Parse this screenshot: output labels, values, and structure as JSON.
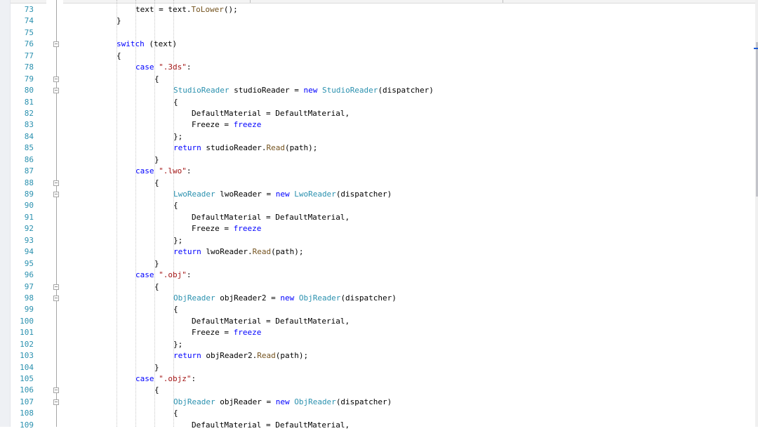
{
  "editor": {
    "colors": {
      "line_number": "#2b91af",
      "keyword": "#0000ff",
      "type": "#2b91af",
      "string": "#a31515",
      "method": "#74531f",
      "text": "#000000"
    },
    "lines": [
      {
        "no": "73",
        "indent": 4,
        "fold": "",
        "tokens": [
          {
            "t": "text = text.",
            "c": "plain"
          },
          {
            "t": "ToLower",
            "c": "meth"
          },
          {
            "t": "();",
            "c": "plain"
          }
        ]
      },
      {
        "no": "74",
        "indent": 3,
        "fold": "",
        "tokens": [
          {
            "t": "}",
            "c": "plain"
          }
        ]
      },
      {
        "no": "75",
        "indent": 0,
        "fold": "",
        "tokens": []
      },
      {
        "no": "76",
        "indent": 3,
        "fold": "minus",
        "tokens": [
          {
            "t": "switch",
            "c": "kw"
          },
          {
            "t": " (text)",
            "c": "plain"
          }
        ]
      },
      {
        "no": "77",
        "indent": 3,
        "fold": "",
        "tokens": [
          {
            "t": "{",
            "c": "plain"
          }
        ]
      },
      {
        "no": "78",
        "indent": 4,
        "fold": "",
        "tokens": [
          {
            "t": "case",
            "c": "kw"
          },
          {
            "t": " ",
            "c": "plain"
          },
          {
            "t": "\".3ds\"",
            "c": "str"
          },
          {
            "t": ":",
            "c": "plain"
          }
        ]
      },
      {
        "no": "79",
        "indent": 5,
        "fold": "minus",
        "tokens": [
          {
            "t": "{",
            "c": "plain"
          }
        ]
      },
      {
        "no": "80",
        "indent": 6,
        "fold": "minus",
        "tokens": [
          {
            "t": "StudioReader",
            "c": "type"
          },
          {
            "t": " studioReader = ",
            "c": "plain"
          },
          {
            "t": "new",
            "c": "kw"
          },
          {
            "t": " ",
            "c": "plain"
          },
          {
            "t": "StudioReader",
            "c": "type"
          },
          {
            "t": "(dispatcher)",
            "c": "plain"
          }
        ]
      },
      {
        "no": "81",
        "indent": 6,
        "fold": "",
        "tokens": [
          {
            "t": "{",
            "c": "plain"
          }
        ]
      },
      {
        "no": "82",
        "indent": 7,
        "fold": "",
        "tokens": [
          {
            "t": "DefaultMaterial = DefaultMaterial,",
            "c": "plain"
          }
        ]
      },
      {
        "no": "83",
        "indent": 7,
        "fold": "",
        "tokens": [
          {
            "t": "Freeze = ",
            "c": "plain"
          },
          {
            "t": "freeze",
            "c": "kw"
          }
        ]
      },
      {
        "no": "84",
        "indent": 6,
        "fold": "",
        "tokens": [
          {
            "t": "};",
            "c": "plain"
          }
        ]
      },
      {
        "no": "85",
        "indent": 6,
        "fold": "",
        "tokens": [
          {
            "t": "return",
            "c": "kw"
          },
          {
            "t": " studioReader.",
            "c": "plain"
          },
          {
            "t": "Read",
            "c": "meth"
          },
          {
            "t": "(path);",
            "c": "plain"
          }
        ]
      },
      {
        "no": "86",
        "indent": 5,
        "fold": "",
        "tokens": [
          {
            "t": "}",
            "c": "plain"
          }
        ]
      },
      {
        "no": "87",
        "indent": 4,
        "fold": "",
        "tokens": [
          {
            "t": "case",
            "c": "kw"
          },
          {
            "t": " ",
            "c": "plain"
          },
          {
            "t": "\".lwo\"",
            "c": "str"
          },
          {
            "t": ":",
            "c": "plain"
          }
        ]
      },
      {
        "no": "88",
        "indent": 5,
        "fold": "minus",
        "tokens": [
          {
            "t": "{",
            "c": "plain"
          }
        ]
      },
      {
        "no": "89",
        "indent": 6,
        "fold": "minus",
        "tokens": [
          {
            "t": "LwoReader",
            "c": "type"
          },
          {
            "t": " lwoReader = ",
            "c": "plain"
          },
          {
            "t": "new",
            "c": "kw"
          },
          {
            "t": " ",
            "c": "plain"
          },
          {
            "t": "LwoReader",
            "c": "type"
          },
          {
            "t": "(dispatcher)",
            "c": "plain"
          }
        ]
      },
      {
        "no": "90",
        "indent": 6,
        "fold": "",
        "tokens": [
          {
            "t": "{",
            "c": "plain"
          }
        ]
      },
      {
        "no": "91",
        "indent": 7,
        "fold": "",
        "tokens": [
          {
            "t": "DefaultMaterial = DefaultMaterial,",
            "c": "plain"
          }
        ]
      },
      {
        "no": "92",
        "indent": 7,
        "fold": "",
        "tokens": [
          {
            "t": "Freeze = ",
            "c": "plain"
          },
          {
            "t": "freeze",
            "c": "kw"
          }
        ]
      },
      {
        "no": "93",
        "indent": 6,
        "fold": "",
        "tokens": [
          {
            "t": "};",
            "c": "plain"
          }
        ]
      },
      {
        "no": "94",
        "indent": 6,
        "fold": "",
        "tokens": [
          {
            "t": "return",
            "c": "kw"
          },
          {
            "t": " lwoReader.",
            "c": "plain"
          },
          {
            "t": "Read",
            "c": "meth"
          },
          {
            "t": "(path);",
            "c": "plain"
          }
        ]
      },
      {
        "no": "95",
        "indent": 5,
        "fold": "",
        "tokens": [
          {
            "t": "}",
            "c": "plain"
          }
        ]
      },
      {
        "no": "96",
        "indent": 4,
        "fold": "",
        "tokens": [
          {
            "t": "case",
            "c": "kw"
          },
          {
            "t": " ",
            "c": "plain"
          },
          {
            "t": "\".obj\"",
            "c": "str"
          },
          {
            "t": ":",
            "c": "plain"
          }
        ]
      },
      {
        "no": "97",
        "indent": 5,
        "fold": "minus",
        "tokens": [
          {
            "t": "{",
            "c": "plain"
          }
        ]
      },
      {
        "no": "98",
        "indent": 6,
        "fold": "minus",
        "tokens": [
          {
            "t": "ObjReader",
            "c": "type"
          },
          {
            "t": " objReader2 = ",
            "c": "plain"
          },
          {
            "t": "new",
            "c": "kw"
          },
          {
            "t": " ",
            "c": "plain"
          },
          {
            "t": "ObjReader",
            "c": "type"
          },
          {
            "t": "(dispatcher)",
            "c": "plain"
          }
        ]
      },
      {
        "no": "99",
        "indent": 6,
        "fold": "",
        "tokens": [
          {
            "t": "{",
            "c": "plain"
          }
        ]
      },
      {
        "no": "100",
        "indent": 7,
        "fold": "",
        "tokens": [
          {
            "t": "DefaultMaterial = DefaultMaterial,",
            "c": "plain"
          }
        ]
      },
      {
        "no": "101",
        "indent": 7,
        "fold": "",
        "tokens": [
          {
            "t": "Freeze = ",
            "c": "plain"
          },
          {
            "t": "freeze",
            "c": "kw"
          }
        ]
      },
      {
        "no": "102",
        "indent": 6,
        "fold": "",
        "tokens": [
          {
            "t": "};",
            "c": "plain"
          }
        ]
      },
      {
        "no": "103",
        "indent": 6,
        "fold": "",
        "tokens": [
          {
            "t": "return",
            "c": "kw"
          },
          {
            "t": " objReader2.",
            "c": "plain"
          },
          {
            "t": "Read",
            "c": "meth"
          },
          {
            "t": "(path);",
            "c": "plain"
          }
        ]
      },
      {
        "no": "104",
        "indent": 5,
        "fold": "",
        "tokens": [
          {
            "t": "}",
            "c": "plain"
          }
        ]
      },
      {
        "no": "105",
        "indent": 4,
        "fold": "",
        "tokens": [
          {
            "t": "case",
            "c": "kw"
          },
          {
            "t": " ",
            "c": "plain"
          },
          {
            "t": "\".objz\"",
            "c": "str"
          },
          {
            "t": ":",
            "c": "plain"
          }
        ]
      },
      {
        "no": "106",
        "indent": 5,
        "fold": "minus",
        "tokens": [
          {
            "t": "{",
            "c": "plain"
          }
        ]
      },
      {
        "no": "107",
        "indent": 6,
        "fold": "minus",
        "tokens": [
          {
            "t": "ObjReader",
            "c": "type"
          },
          {
            "t": " objReader = ",
            "c": "plain"
          },
          {
            "t": "new",
            "c": "kw"
          },
          {
            "t": " ",
            "c": "plain"
          },
          {
            "t": "ObjReader",
            "c": "type"
          },
          {
            "t": "(dispatcher)",
            "c": "plain"
          }
        ]
      },
      {
        "no": "108",
        "indent": 6,
        "fold": "",
        "tokens": [
          {
            "t": "{",
            "c": "plain"
          }
        ]
      },
      {
        "no": "109",
        "indent": 7,
        "fold": "",
        "tokens": [
          {
            "t": "DefaultMaterial = DefaultMaterial,",
            "c": "plain"
          }
        ]
      }
    ]
  }
}
